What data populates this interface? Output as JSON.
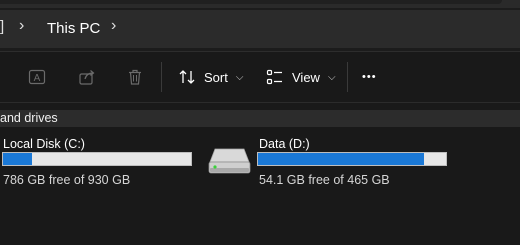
{
  "address": {
    "edge_glyph": "]",
    "location": "This PC"
  },
  "toolbar": {
    "sort_label": "Sort",
    "view_label": "View",
    "more_label": "•••"
  },
  "group": {
    "header": "and drives"
  },
  "drives": [
    {
      "name": "Local Disk (C:)",
      "free_text": "786 GB free of 930 GB",
      "used_fraction": 0.155
    },
    {
      "name": "Data (D:)",
      "free_text": "54.1 GB free of 465 GB",
      "used_fraction": 0.884
    }
  ],
  "colors": {
    "usage_fill": "#1a78d6",
    "usage_track": "#e6e6e6",
    "background": "#191919"
  }
}
